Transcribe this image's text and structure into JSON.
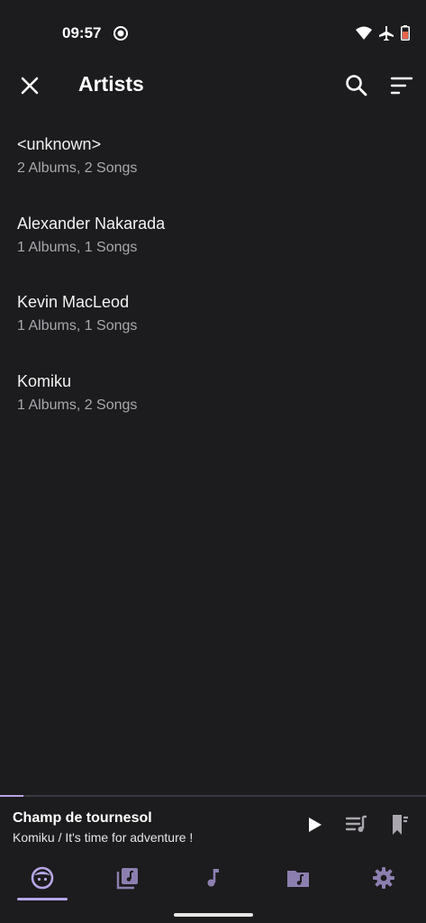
{
  "status_bar": {
    "time": "09:57"
  },
  "app_bar": {
    "title": "Artists"
  },
  "artists": [
    {
      "name": "<unknown>",
      "meta": "2 Albums,  2 Songs"
    },
    {
      "name": "Alexander Nakarada",
      "meta": "1 Albums,  1 Songs"
    },
    {
      "name": "Kevin MacLeod",
      "meta": "1 Albums,  1 Songs"
    },
    {
      "name": "Komiku",
      "meta": "1 Albums,  2 Songs"
    }
  ],
  "mini_player": {
    "title": "Champ de tournesol",
    "subtitle": "Komiku / It's time for adventure !",
    "progress": 0.055
  },
  "bottom_nav": {
    "active": "artists"
  },
  "colors": {
    "accent": "#b6a6e6",
    "nav_icon": "#8c7fb0",
    "background": "#1c1b1d",
    "secondary_text": "#a9a7ad"
  }
}
